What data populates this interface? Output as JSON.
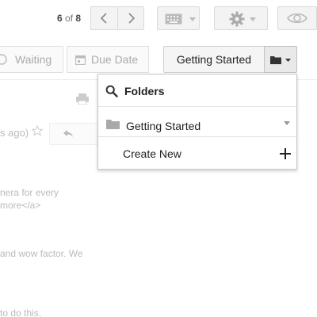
{
  "toolbar": {
    "page_current": "6",
    "page_of": "of",
    "page_total": "8"
  },
  "actions": {
    "waiting_label": "Waiting",
    "due_date_label": "Due Date",
    "label_button": "Getting Started"
  },
  "folders_menu": {
    "title": "Folders",
    "items": [
      {
        "label": "Getting Started"
      }
    ],
    "create_label": "Create New"
  },
  "email": {
    "time_fragment": "s ago)",
    "lines": [
      "nera for every",
      "more</a>",
      "and wow factor. We",
      " to do this."
    ]
  },
  "colors": {
    "menu_border": "#c8c8c8",
    "button_bg": "#f5f5f5",
    "faded_text": "#bbbbbb"
  }
}
